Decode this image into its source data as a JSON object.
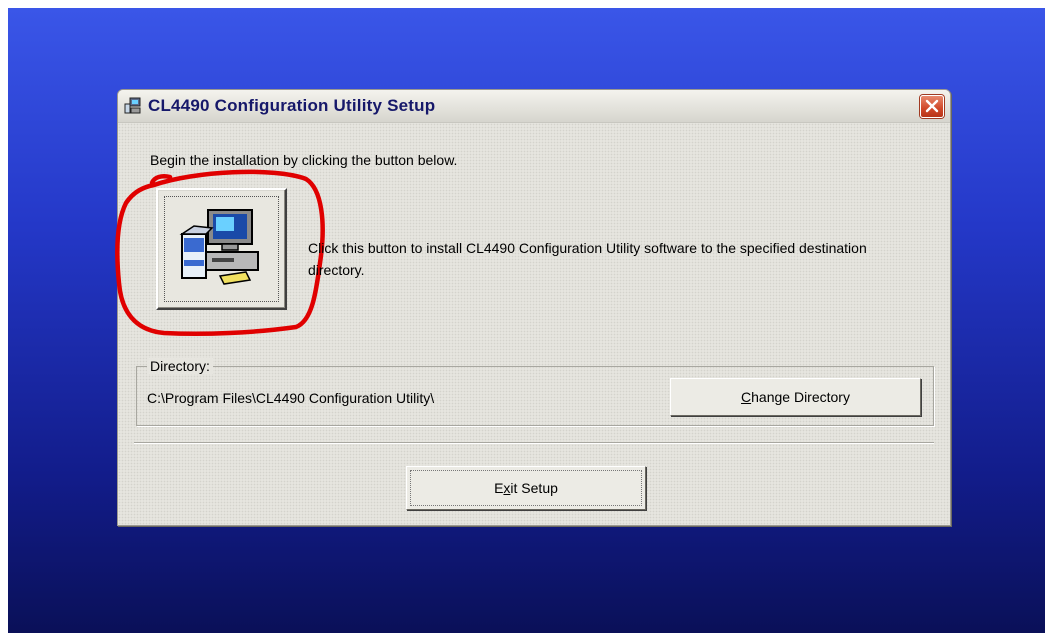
{
  "window": {
    "title": "CL4490 Configuration Utility Setup",
    "close_icon": "close-icon"
  },
  "content": {
    "intro": "Begin the installation by clicking the button below.",
    "install_button_icon": "computer-install-icon",
    "install_description": "Click this button to install CL4490 Configuration Utility software to the specified destination directory.",
    "annotation_color": "#e00000"
  },
  "directory": {
    "legend": "Directory:",
    "path": "C:\\Program Files\\CL4490 Configuration Utility\\",
    "change_label_mnemonic": "C",
    "change_label_rest": "hange Directory"
  },
  "footer": {
    "exit_label_pre": "E",
    "exit_label_mnemonic": "x",
    "exit_label_rest": "it Setup"
  },
  "colors": {
    "desktop_top": "#3a56e8",
    "desktop_bottom": "#0a1058",
    "title_text": "#16186a",
    "close_button": "#d0482a"
  }
}
